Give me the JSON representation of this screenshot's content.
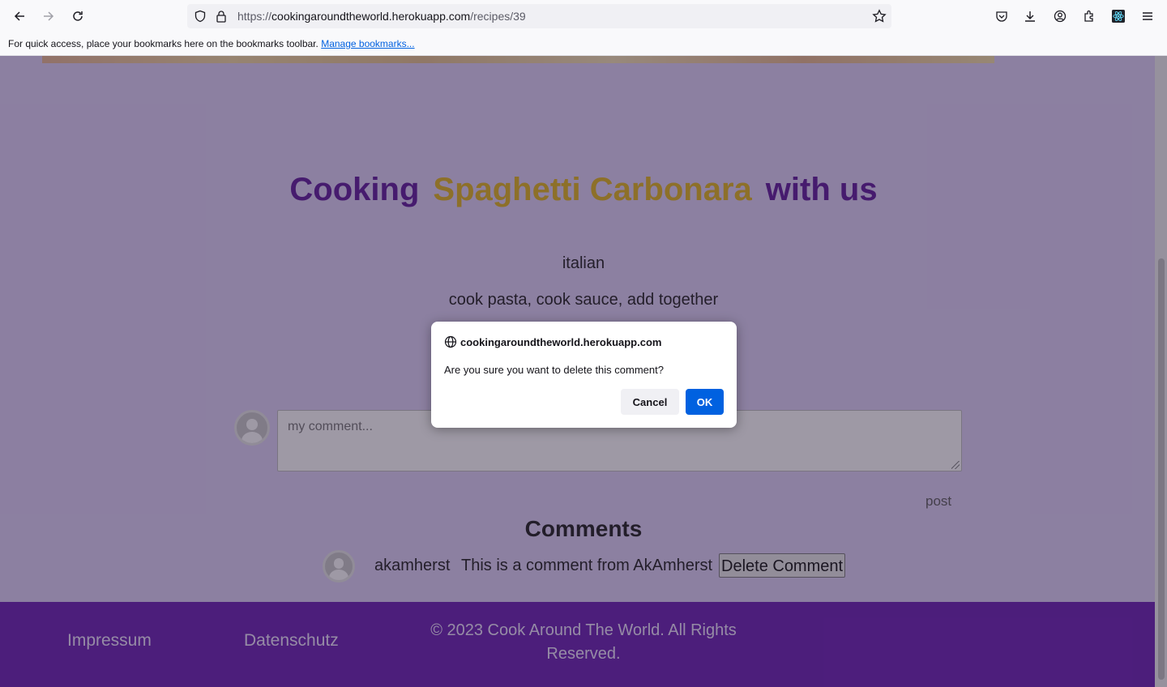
{
  "browser": {
    "url_scheme": "https://",
    "url_host": "cookingaroundtheworld.herokuapp.com",
    "url_path": "/recipes/39",
    "bookmarks_message": "For quick access, place your bookmarks here on the bookmarks toolbar.",
    "bookmarks_link": "Manage bookmarks..."
  },
  "recipe": {
    "title_prefix": "Cooking",
    "title_name": "Spaghetti Carbonara",
    "title_suffix": "with us",
    "cuisine": "italian",
    "instructions": "cook pasta, cook sauce, add together"
  },
  "comment_form": {
    "placeholder": "my comment...",
    "post_label": "post"
  },
  "comments": {
    "heading": "Comments",
    "items": [
      {
        "user": "akamherst",
        "text": "This is a comment from AkAmherst",
        "delete_label": "Delete Comment"
      }
    ]
  },
  "footer": {
    "impressum": "Impressum",
    "datenschutz": "Datenschutz",
    "copyright": "© 2023 Cook Around The World. All Rights Reserved."
  },
  "dialog": {
    "origin": "cookingaroundtheworld.herokuapp.com",
    "message": "Are you sure you want to delete this comment?",
    "cancel_label": "Cancel",
    "ok_label": "OK"
  },
  "colors": {
    "title_purple": "#5f1a9c",
    "title_gold": "#e0b41e",
    "footer_bg": "#6b1fb3",
    "ok_button": "#0061e0"
  }
}
